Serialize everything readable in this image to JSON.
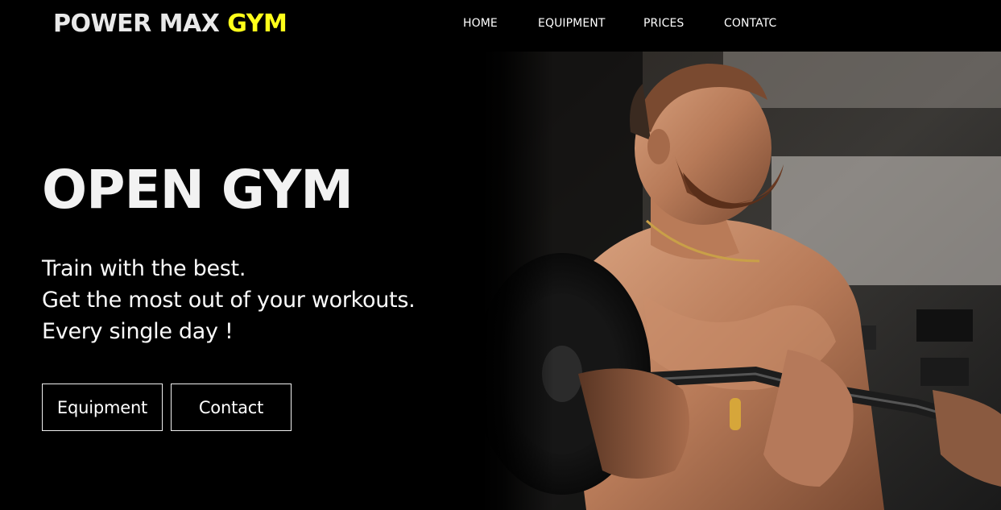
{
  "header": {
    "logo_main": "POWER MAX ",
    "logo_accent": "GYM",
    "nav": [
      "HOME",
      "EQUIPMENT",
      "PRICES",
      "CONTATC"
    ]
  },
  "hero": {
    "title": "OPEN GYM",
    "lines": [
      "Train with the best.",
      "Get the most out of your workouts.",
      "Every single day !"
    ],
    "buttons": [
      "Equipment",
      "Contact"
    ],
    "image": "bodybuilder-lifting-barbell-photo"
  },
  "colors": {
    "background": "#000000",
    "accent": "#ffff1a",
    "text": "#ffffff"
  }
}
